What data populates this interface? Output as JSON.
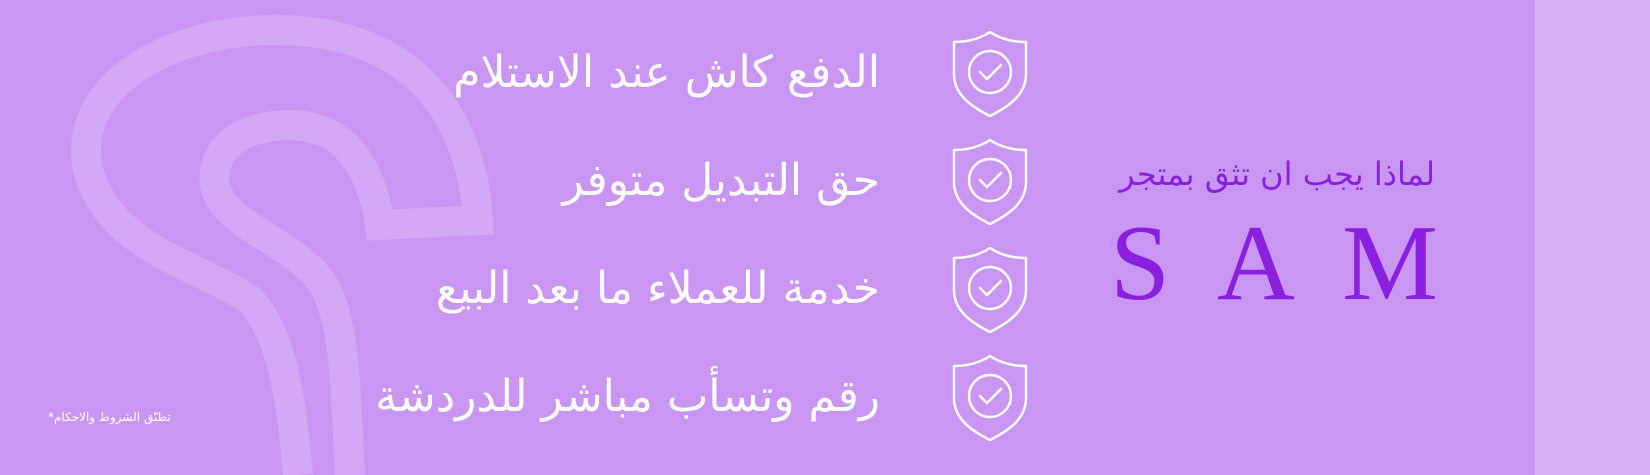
{
  "features": [
    {
      "label": "الدفع كاش عند الاستلام",
      "icon": "shield-check-icon"
    },
    {
      "label": "حق التبديل متوفر",
      "icon": "shield-check-icon"
    },
    {
      "label": "خدمة للعملاء ما بعد البيع",
      "icon": "shield-check-icon"
    },
    {
      "label": "رقم وتسأب مباشر للدردشة",
      "icon": "shield-check-icon"
    }
  ],
  "brand": {
    "tagline": "لماذا يجب ان تثق بمتجر",
    "letters": [
      "S",
      "A",
      "M"
    ]
  },
  "terms_note": "تطبّق الشروط والاحكام*",
  "colors": {
    "background": "#c996f3",
    "side_strip": "#d9b2f6",
    "brand_purple": "#8a1fe0",
    "text_white": "#ffffff"
  }
}
